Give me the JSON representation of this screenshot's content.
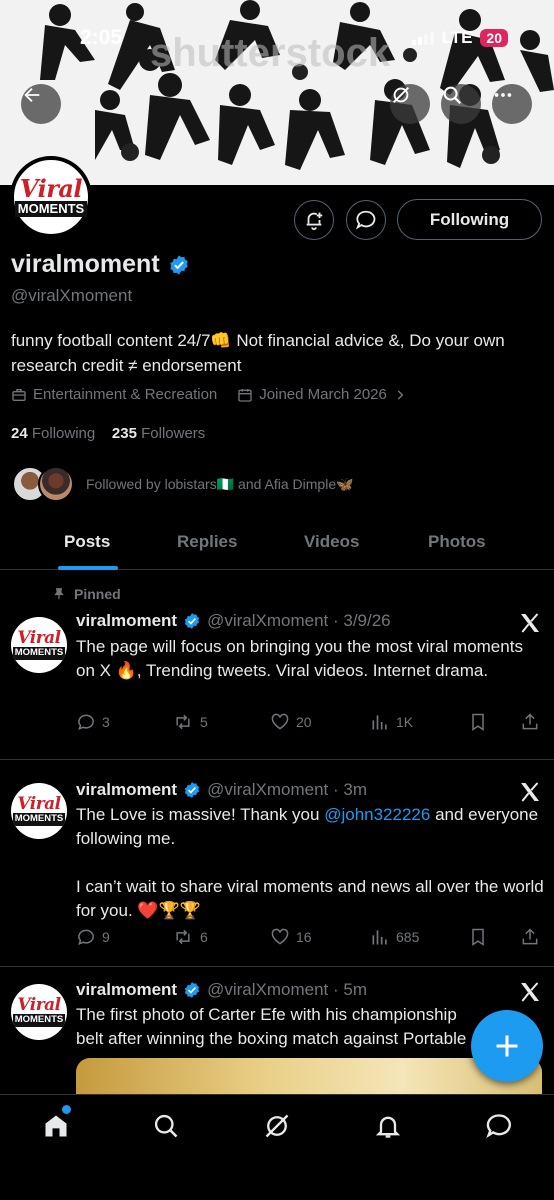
{
  "status_bar": {
    "time": "2:05",
    "network": "LTE",
    "battery": "20"
  },
  "banner": {
    "watermark": "shutterstock"
  },
  "profile": {
    "avatar_text_top": "Viral",
    "avatar_text_bottom": "MOMENTS",
    "display_name": "viralmoment",
    "handle": "@viralXmoment",
    "bio": "funny football content 24/7👊 Not financial advice &, Do your own research credit ≠ endorsement",
    "category": "Entertainment & Recreation",
    "joined": "Joined March 2026",
    "following_count": "24",
    "following_label": "Following",
    "followers_count": "235",
    "followers_label": "Followers",
    "followed_by": "Followed by lobistars🇳🇬 and Afia Dimple🦋",
    "follow_button_label": "Following"
  },
  "tabs": [
    {
      "label": "Posts",
      "active": true
    },
    {
      "label": "Replies",
      "active": false
    },
    {
      "label": "Videos",
      "active": false
    },
    {
      "label": "Photos",
      "active": false
    }
  ],
  "pinned_label": "Pinned",
  "posts": [
    {
      "name": "viralmoment",
      "handle_time": "@viralXmoment · 3/9/26",
      "text": "The page will focus on bringing you the most viral moments on X 🔥, Trending tweets. Viral videos. Internet drama.",
      "replies": "3",
      "reposts": "5",
      "likes": "20",
      "views": "1K"
    },
    {
      "name": "viralmoment",
      "handle_time": "@viralXmoment · 3m",
      "text_before": "The Love is massive! Thank you ",
      "mention": "@john322226",
      "text_after": " and everyone following me.\n\nI can’t wait to share viral moments and news all over the world for you. ❤️🏆🏆",
      "replies": "9",
      "reposts": "6",
      "likes": "16",
      "views": "685"
    },
    {
      "name": "viralmoment",
      "handle_time": "@viralXmoment · 5m",
      "text": "The first photo of Carter Efe with his championship belt after winning the boxing match against Portable"
    }
  ],
  "colors": {
    "accent": "#1d9bf0",
    "muted": "#71767b",
    "border": "#2f3336",
    "brand_red": "#d01f27"
  }
}
